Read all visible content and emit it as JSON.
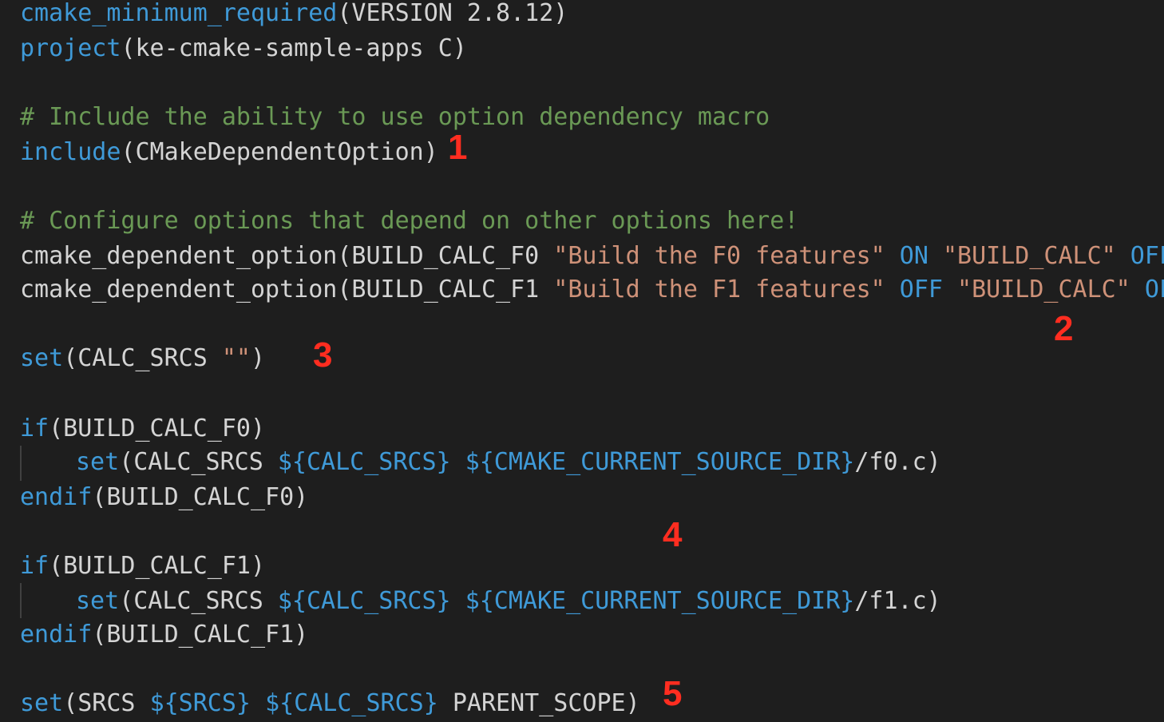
{
  "lines": {
    "l1": {
      "kw": "cmake_minimum_required",
      "rest": "(VERSION 2.8.12)"
    },
    "l2": {
      "kw": "project",
      "rest": "(ke-cmake-sample-apps C)"
    },
    "l3": {
      "comment": "# Include the ability to use option dependency macro"
    },
    "l4": {
      "kw": "include",
      "rest": "(CMakeDependentOption)"
    },
    "l5": {
      "comment": "# Configure options that depend on other options here!"
    },
    "l6": {
      "fn": "cmake_dependent_option(BUILD_CALC_F0 ",
      "str1": "\"Build the F0 features\"",
      "val1": "ON",
      "str2": "\"BUILD_CALC\"",
      "val2": "OFF",
      "close": ")"
    },
    "l7": {
      "fn": "cmake_dependent_option(BUILD_CALC_F1 ",
      "str1": "\"Build the F1 features\"",
      "val1": "OFF",
      "str2": "\"BUILD_CALC\"",
      "val2": "OFF",
      "close": ")"
    },
    "l8": {
      "kw": "set",
      "p1": "(CALC_SRCS ",
      "str": "\"\"",
      "p2": ")"
    },
    "l9": {
      "kw": "if",
      "rest": "(BUILD_CALC_F0)"
    },
    "l10": {
      "kw": "set",
      "p1": "(CALC_SRCS ",
      "v1": "${CALC_SRCS}",
      "v2": "${CMAKE_CURRENT_SOURCE_DIR}",
      "tail": "/f0.c)"
    },
    "l11": {
      "kw": "endif",
      "rest": "(BUILD_CALC_F0)"
    },
    "l12": {
      "kw": "if",
      "rest": "(BUILD_CALC_F1)"
    },
    "l13": {
      "kw": "set",
      "p1": "(CALC_SRCS ",
      "v1": "${CALC_SRCS}",
      "v2": "${CMAKE_CURRENT_SOURCE_DIR}",
      "tail": "/f1.c)"
    },
    "l14": {
      "kw": "endif",
      "rest": "(BUILD_CALC_F1)"
    },
    "l15": {
      "kw": "set",
      "p1": "(SRCS ",
      "v1": "${SRCS}",
      "v2": "${CALC_SRCS}",
      "tail": " PARENT_SCOPE)"
    }
  },
  "annotations": {
    "a1": "1",
    "a2": "2",
    "a3": "3",
    "a4": "4",
    "a5": "5"
  },
  "colors": {
    "background": "#1e1e1e",
    "keyword": "#3f9ad8",
    "comment": "#6a9955",
    "string": "#ce9178",
    "text": "#d4d4d4",
    "annotation": "#ff2d20"
  }
}
